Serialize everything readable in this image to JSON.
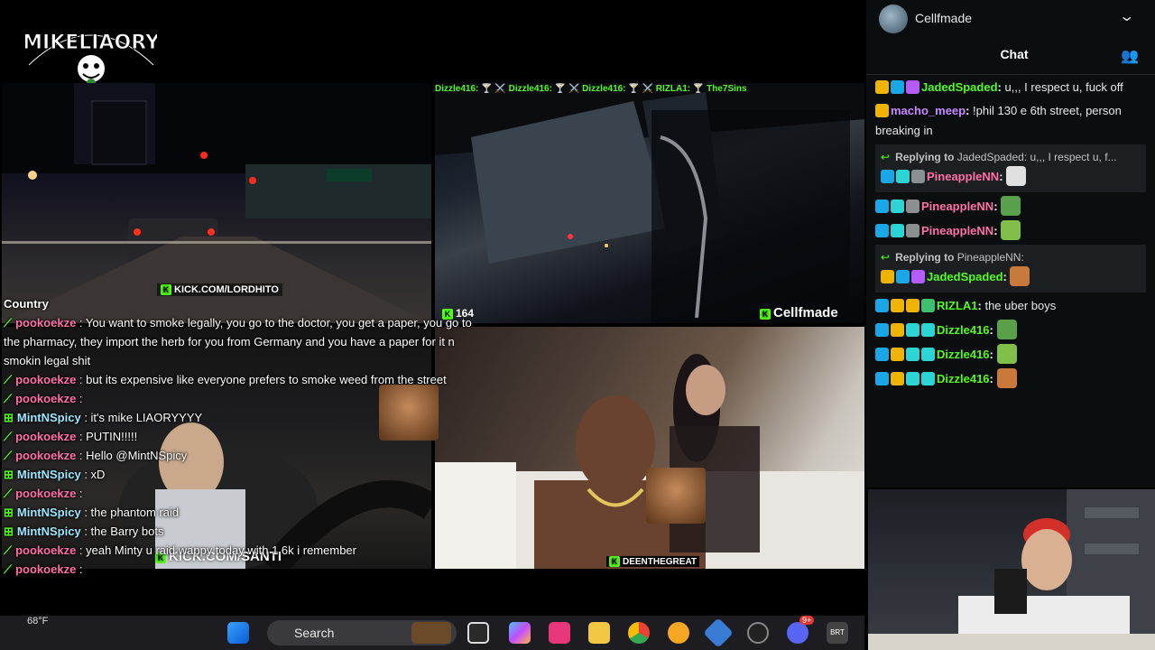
{
  "logo": {
    "text": "MIKELIAORY"
  },
  "streams": {
    "top_right": {
      "ticker": "Dizzle416: 🍸 ⚔️ Dizzle416: 🍸 ⚔️ Dizzle416: 🍸 ⚔️ RIZLA1: 🍸 The7Sins",
      "viewer_count": "164",
      "channel_tag": "Cellfmade"
    },
    "top_left": {
      "url": "KICK.COM/LORDHITO"
    },
    "bottom_left": {
      "url": "KICK.COM/SANTI"
    },
    "bottom_right": {
      "url": "DEENTHEGREAT"
    }
  },
  "overlay_chat": {
    "country_label": "Country",
    "lines": [
      {
        "user": "pookoekze",
        "text": " : You want to smoke legally, you go to the doctor, you get a paper, you go to the pharmacy, they import the herb for you from Germany and you have a paper for it n smokin legal shit"
      },
      {
        "user": "pookoekze",
        "text": " : but its expensive like everyone prefers to smoke weed from the street"
      },
      {
        "user": "pookoekze",
        "text": " : "
      },
      {
        "user": "MintNSpicy",
        "text": " : it's mike LIAORYYYY"
      },
      {
        "user": "pookoekze",
        "text": " : PUTIN!!!!!"
      },
      {
        "user": "pookoekze",
        "text": " : Hello @MintNSpicy"
      },
      {
        "user": "MintNSpicy",
        "text": " : xD"
      },
      {
        "user": "pookoekze",
        "text": " : "
      },
      {
        "user": "MintNSpicy",
        "text": " : the phantom raid"
      },
      {
        "user": "MintNSpicy",
        "text": " : the Barry bots"
      },
      {
        "user": "pookoekze",
        "text": " : yeah Minty u raid wappy today with 1.6k i remember"
      },
      {
        "user": "pookoekze",
        "text": " : "
      }
    ]
  },
  "taskbar": {
    "weather": "68°F",
    "search_placeholder": "Search",
    "notification_count": "9+"
  },
  "chat_panel": {
    "channel_name": "Cellfmade",
    "title": "Chat",
    "messages": [
      {
        "type": "msg",
        "user": "JadedSpaded",
        "color": "#53fc18",
        "text": "u,,, I respect u, fuck off"
      },
      {
        "type": "msg",
        "user": "macho_meep",
        "color": "#c886ff",
        "text": "!phil 130 e 6th street, person breaking in"
      },
      {
        "type": "reply",
        "reply_label": "Replying to",
        "reply_to": "JadedSpaded: u,,, I respect u, f...",
        "user": "PineappleNN",
        "color": "#ff6fa8",
        "text": ""
      },
      {
        "type": "msg",
        "user": "PineappleNN",
        "color": "#ff6fa8",
        "text": ""
      },
      {
        "type": "msg",
        "user": "PineappleNN",
        "color": "#ff6fa8",
        "text": ""
      },
      {
        "type": "reply",
        "reply_label": "Replying to",
        "reply_to": "PineappleNN:",
        "user": "JadedSpaded",
        "color": "#53fc18",
        "text": ""
      },
      {
        "type": "msg",
        "user": "RIZLA1",
        "color": "#53fc18",
        "text": "the uber boys"
      },
      {
        "type": "msg",
        "user": "Dizzle416",
        "color": "#53fc18",
        "text": ""
      },
      {
        "type": "msg",
        "user": "Dizzle416",
        "color": "#53fc18",
        "text": ""
      },
      {
        "type": "msg",
        "user": "Dizzle416",
        "color": "#53fc18",
        "text": ""
      }
    ]
  }
}
